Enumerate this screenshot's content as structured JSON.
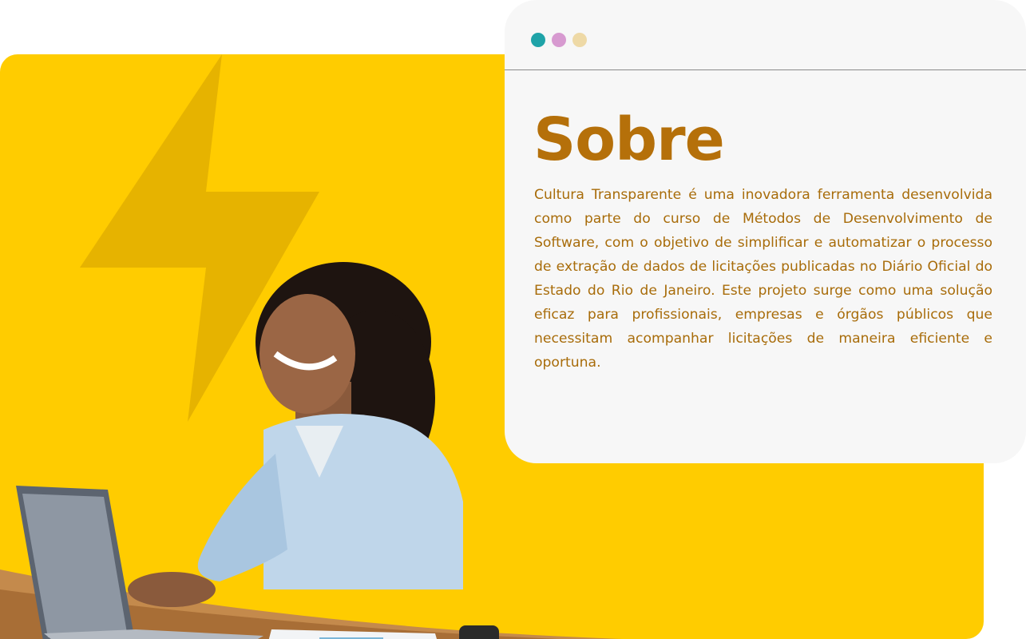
{
  "colors": {
    "accent_yellow": "#FFCC00",
    "bolt_yellow": "#E6B300",
    "title_brown": "#B5700A",
    "text_brown": "#A86C0A",
    "card_bg": "#F7F7F7"
  },
  "window_dots": [
    {
      "name": "teal-dot",
      "color": "#1FA3A8"
    },
    {
      "name": "pink-dot",
      "color": "#D79AD0"
    },
    {
      "name": "beige-dot",
      "color": "#EED9A6"
    }
  ],
  "about": {
    "title": "Sobre",
    "description": "Cultura Transparente é uma inovadora ferramenta desenvolvida como parte do curso de Métodos de Desenvolvimento de Software, com o objetivo de simplificar e automatizar o processo de extração de dados de licitações publicadas no Diário Oficial do Estado do Rio de Janeiro. Este projeto surge como uma solução eficaz para profissionais, empresas e órgãos públicos que necessitam acompanhar licitações de maneira eficiente e oportuna."
  },
  "illustration": {
    "bolt_icon": "lightning-bolt-icon",
    "photo": "woman-typing-on-laptop"
  }
}
